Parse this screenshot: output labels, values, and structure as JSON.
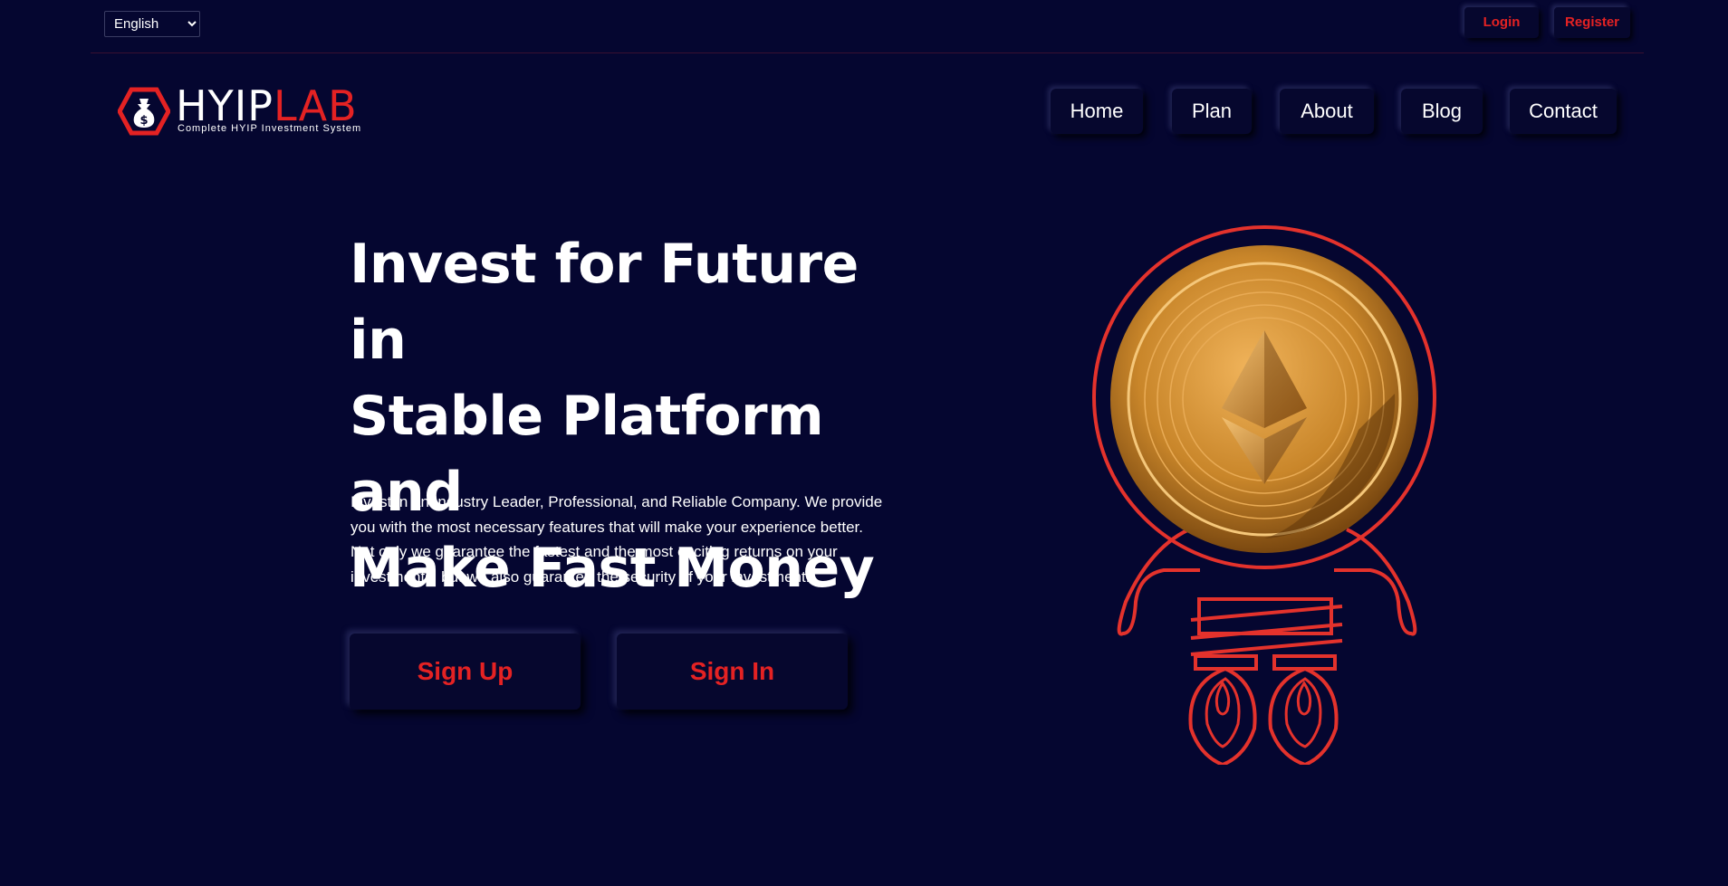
{
  "topbar": {
    "language": {
      "selected": "English",
      "options": [
        "English"
      ]
    },
    "login_label": "Login",
    "register_label": "Register"
  },
  "brand": {
    "name_part1": "HYIP",
    "name_part2": "LAB",
    "tagline": "Complete HYIP Investment System",
    "logo_icon": "money-bag-icon"
  },
  "nav": {
    "items": [
      {
        "label": "Home"
      },
      {
        "label": "Plan"
      },
      {
        "label": "About"
      },
      {
        "label": "Blog"
      },
      {
        "label": "Contact"
      }
    ]
  },
  "hero": {
    "title_line1": "Invest for Future in",
    "title_line2": "Stable Platform and",
    "title_line3": "Make Fast Money",
    "description": "Invest in an Industry Leader, Professional, and Reliable Company. We provide you with the most necessary features that will make your experience better. Not only we guarantee the fastest and the most exciting returns on your investments, but we also guarantee the security of your investment.",
    "signup_label": "Sign Up",
    "signin_label": "Sign In",
    "illustration": "ethereum-coin-rocket-icon"
  },
  "colors": {
    "background": "#050630",
    "accent": "#e42223",
    "text": "#ffffff",
    "coin_gold": "#c9862a"
  }
}
